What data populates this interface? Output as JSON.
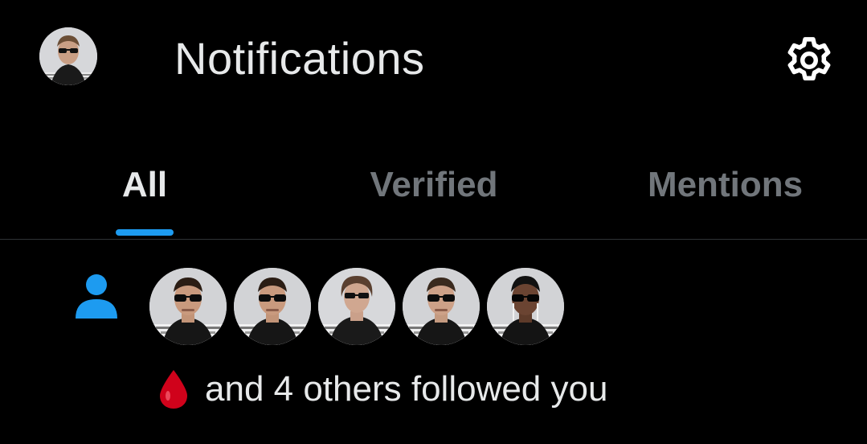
{
  "header": {
    "title": "Notifications",
    "avatar_icon": "user-avatar",
    "settings_icon": "gear-icon"
  },
  "tabs": [
    {
      "label": "All",
      "active": true
    },
    {
      "label": "Verified",
      "active": false
    },
    {
      "label": "Mentions",
      "active": false
    }
  ],
  "notification": {
    "type_icon": "person-icon",
    "follower_avatar_count": 5,
    "emoji": "drop-of-blood",
    "text": "and 4 others followed you"
  },
  "colors": {
    "background": "#000000",
    "text_primary": "#e7e9ea",
    "text_secondary": "#71767b",
    "accent": "#1d9bf0",
    "divider": "#2f3336",
    "emoji_red": "#d0021b"
  }
}
